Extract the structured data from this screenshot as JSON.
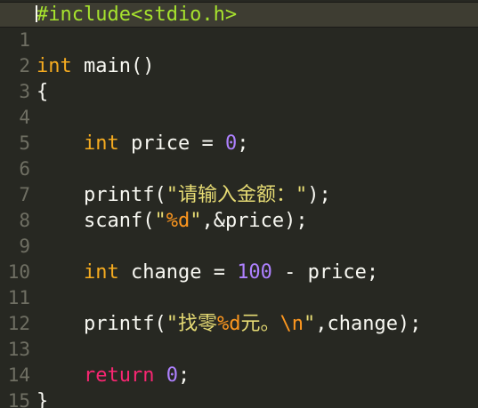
{
  "editor": {
    "theme_colors": {
      "background": "#272822",
      "current_line": "#3e3d32",
      "line_number": "#6f6f63",
      "text": "#f8f8f2",
      "type_keyword": "#f5ab20",
      "preprocessor": "#a6e22e",
      "number": "#ae81ff",
      "string": "#e6db74",
      "format_specifier": "#fd971f",
      "return_keyword": "#f92672"
    },
    "lines": [
      {
        "num": "",
        "tokens": [
          {
            "t": "#include<stdio.h>",
            "c": "pre"
          }
        ]
      },
      {
        "num": "1",
        "tokens": []
      },
      {
        "num": "2",
        "tokens": [
          {
            "t": "int",
            "c": "type"
          },
          {
            "t": " main()",
            "c": "kw"
          }
        ]
      },
      {
        "num": "3",
        "tokens": [
          {
            "t": "{",
            "c": "punc"
          }
        ]
      },
      {
        "num": "4",
        "tokens": []
      },
      {
        "num": "5",
        "tokens": [
          {
            "t": "    ",
            "c": "kw"
          },
          {
            "t": "int",
            "c": "type"
          },
          {
            "t": " price = ",
            "c": "kw"
          },
          {
            "t": "0",
            "c": "num"
          },
          {
            "t": ";",
            "c": "punc"
          }
        ]
      },
      {
        "num": "6",
        "tokens": []
      },
      {
        "num": "7",
        "tokens": [
          {
            "t": "    printf(",
            "c": "kw"
          },
          {
            "t": "\"请输入金额：\"",
            "c": "str"
          },
          {
            "t": ");",
            "c": "punc"
          }
        ]
      },
      {
        "num": "8",
        "tokens": [
          {
            "t": "    scanf(",
            "c": "kw"
          },
          {
            "t": "\"",
            "c": "str"
          },
          {
            "t": "%d",
            "c": "fmt"
          },
          {
            "t": "\"",
            "c": "str"
          },
          {
            "t": ",&price);",
            "c": "kw"
          }
        ]
      },
      {
        "num": "9",
        "tokens": []
      },
      {
        "num": "10",
        "tokens": [
          {
            "t": "    ",
            "c": "kw"
          },
          {
            "t": "int",
            "c": "type"
          },
          {
            "t": " change = ",
            "c": "kw"
          },
          {
            "t": "100",
            "c": "num"
          },
          {
            "t": " - price;",
            "c": "kw"
          }
        ]
      },
      {
        "num": "11",
        "tokens": []
      },
      {
        "num": "12",
        "tokens": [
          {
            "t": "    printf(",
            "c": "kw"
          },
          {
            "t": "\"找零",
            "c": "str"
          },
          {
            "t": "%d",
            "c": "fmt"
          },
          {
            "t": "元。",
            "c": "str"
          },
          {
            "t": "\\n",
            "c": "fmt"
          },
          {
            "t": "\"",
            "c": "str"
          },
          {
            "t": ",change);",
            "c": "kw"
          }
        ]
      },
      {
        "num": "13",
        "tokens": []
      },
      {
        "num": "14",
        "tokens": [
          {
            "t": "    ",
            "c": "kw"
          },
          {
            "t": "return",
            "c": "ret"
          },
          {
            "t": " ",
            "c": "kw"
          },
          {
            "t": "0",
            "c": "num"
          },
          {
            "t": ";",
            "c": "punc"
          }
        ]
      },
      {
        "num": "15",
        "tokens": [
          {
            "t": "}",
            "c": "punc"
          }
        ]
      }
    ]
  }
}
